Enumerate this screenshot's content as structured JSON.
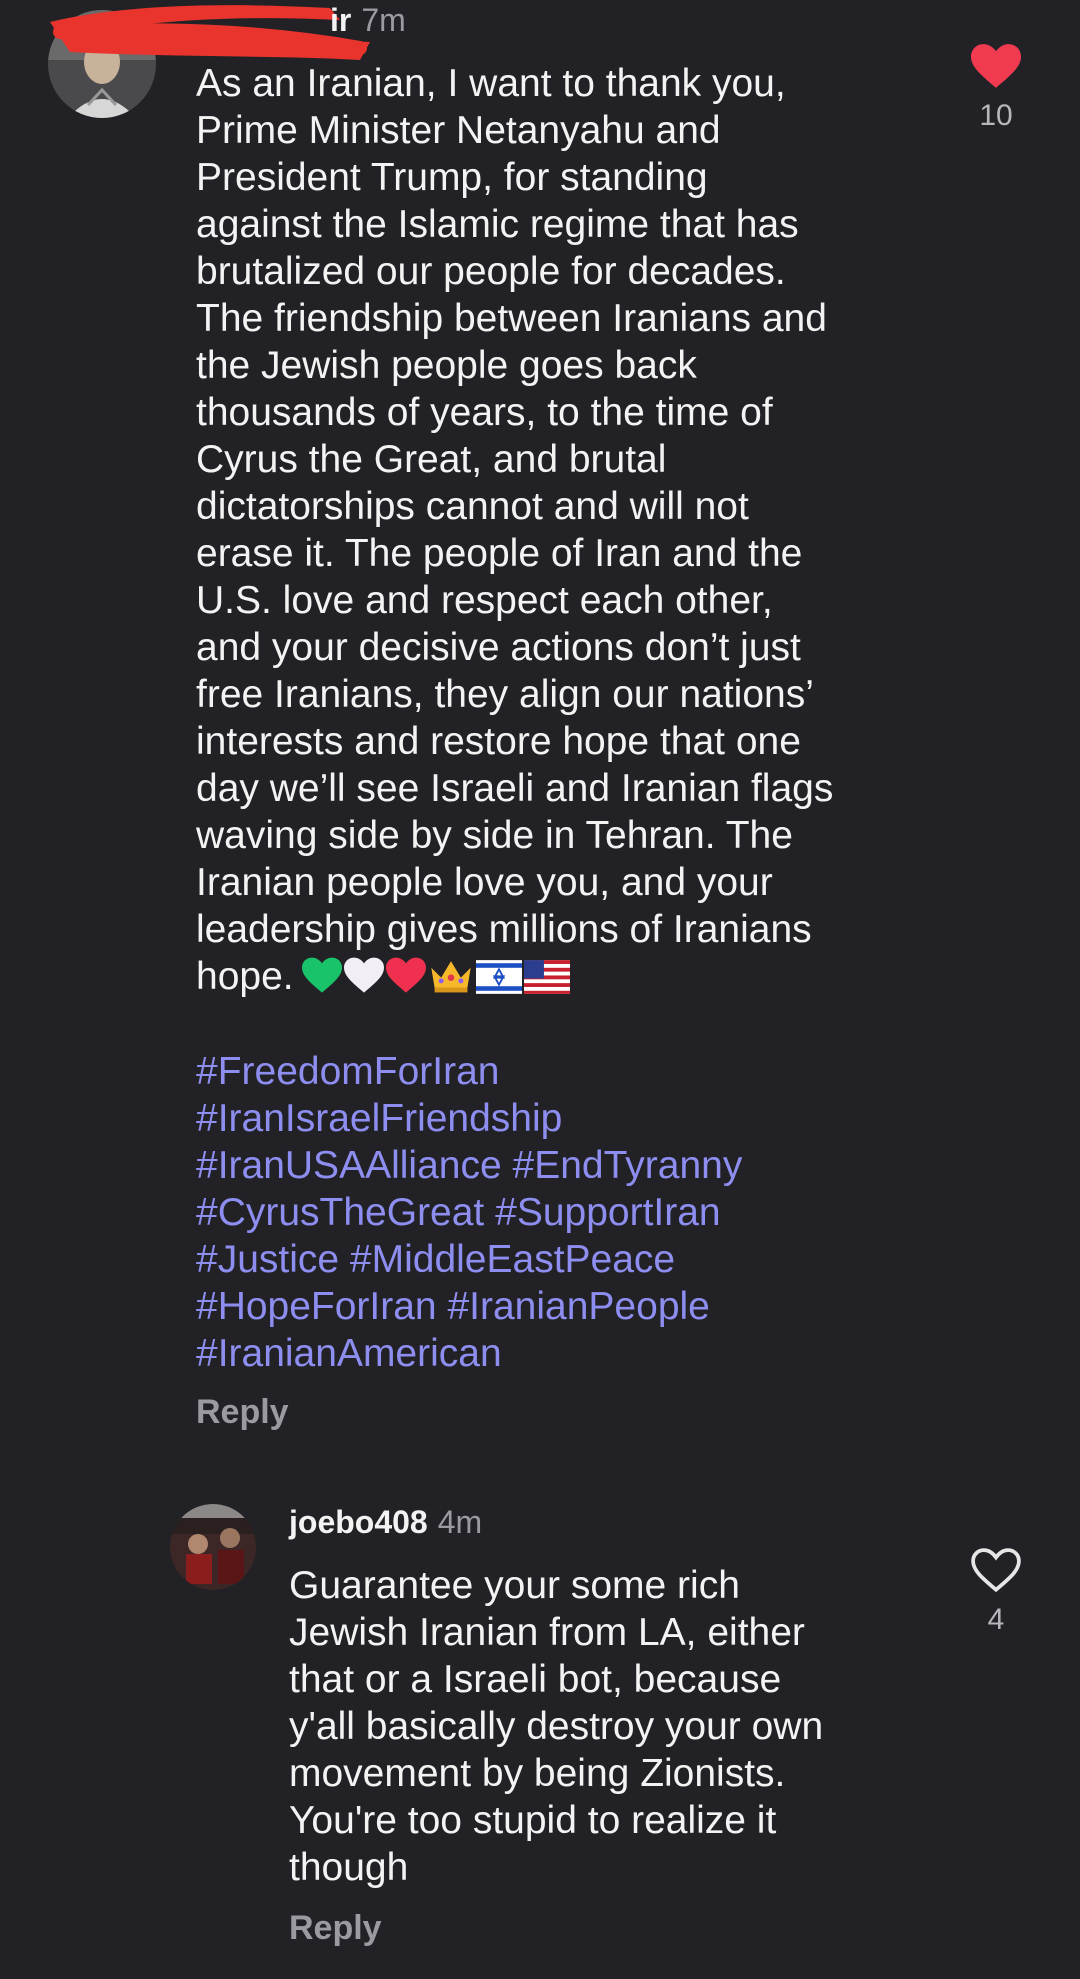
{
  "comments": [
    {
      "username_visible": "ir",
      "timestamp": "7m",
      "liked": true,
      "like_count": "10",
      "reply_label": "Reply",
      "body_lines": [
        "As an Iranian, I want to thank you,",
        "Prime Minister Netanyahu and",
        "President Trump, for standing",
        "against the Islamic regime that has",
        "brutalized our people for decades.",
        "The friendship between Iranians and",
        "the Jewish people goes back",
        "thousands of years, to the time of",
        "Cyrus the Great, and brutal",
        "dictatorships cannot and will not",
        "erase it. The people of Iran and the",
        "U.S. love and respect each other,",
        "and your decisive actions don’t just",
        "free Iranians, they align our nations’",
        "interests and restore hope that one",
        "day we’ll see Israeli and Iranian flags",
        "waving side by side in Tehran. The",
        "Iranian people love you, and your",
        "leadership gives millions of Iranians",
        "hope."
      ],
      "emojis": [
        "green-heart-emoji",
        "white-heart-emoji",
        "red-heart-emoji",
        "crown-emoji",
        "israel-flag-emoji",
        "usa-flag-emoji"
      ],
      "hashtag_lines": [
        [
          "#FreedomForIran"
        ],
        [
          "#IranIsraelFriendship"
        ],
        [
          "#IranUSAAlliance",
          "#EndTyranny"
        ],
        [
          "#CyrusTheGreat",
          "#SupportIran"
        ],
        [
          "#Justice",
          "#MiddleEastPeace"
        ],
        [
          "#HopeForIran",
          "#IranianPeople"
        ],
        [
          "#IranianAmerican"
        ]
      ]
    },
    {
      "username": "joebo408",
      "timestamp": "4m",
      "liked": false,
      "like_count": "4",
      "reply_label": "Reply",
      "body_lines": [
        "Guarantee your some rich",
        "Jewish Iranian from LA, either",
        "that or a Israeli bot, because",
        "y'all basically destroy your own",
        "movement by being Zionists.",
        "You're too stupid to realize it",
        "though"
      ]
    }
  ],
  "colors": {
    "background": "#222226",
    "text": "#f3f3f3",
    "muted": "#9a9aa0",
    "hashtag": "#8d8ef0",
    "like_red": "#ef3a50",
    "redaction": "#e8342c"
  }
}
